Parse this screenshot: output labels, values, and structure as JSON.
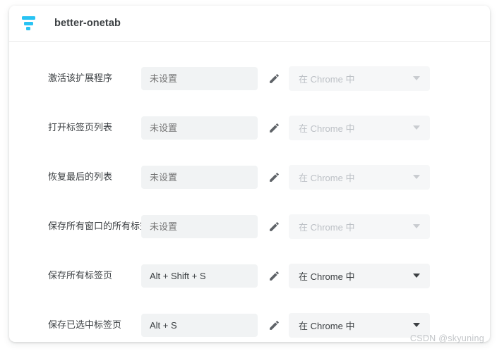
{
  "header": {
    "icon_name": "better-onetab-logo-icon",
    "title": "better-onetab",
    "icon_color": "#29c3f3"
  },
  "rows": [
    {
      "label": "激活该扩展程序",
      "shortcut_value": "",
      "shortcut_placeholder": "未设置",
      "edit_icon": "pencil-icon",
      "scope_value": "在 Chrome 中",
      "scope_enabled": false
    },
    {
      "label": "打开标签页列表",
      "shortcut_value": "",
      "shortcut_placeholder": "未设置",
      "edit_icon": "pencil-icon",
      "scope_value": "在 Chrome 中",
      "scope_enabled": false
    },
    {
      "label": "恢复最后的列表",
      "shortcut_value": "",
      "shortcut_placeholder": "未设置",
      "edit_icon": "pencil-icon",
      "scope_value": "在 Chrome 中",
      "scope_enabled": false
    },
    {
      "label": "保存所有窗口的所有标签页",
      "shortcut_value": "",
      "shortcut_placeholder": "未设置",
      "edit_icon": "pencil-icon",
      "scope_value": "在 Chrome 中",
      "scope_enabled": false
    },
    {
      "label": "保存所有标签页",
      "shortcut_value": "Alt + Shift + S",
      "shortcut_placeholder": "未设置",
      "edit_icon": "pencil-icon",
      "scope_value": "在 Chrome 中",
      "scope_enabled": true
    },
    {
      "label": "保存已选中标签页",
      "shortcut_value": "Alt + S",
      "shortcut_placeholder": "未设置",
      "edit_icon": "pencil-icon",
      "scope_value": "在 Chrome 中",
      "scope_enabled": true
    }
  ],
  "watermark": {
    "text": "CSDN @skyuning"
  }
}
